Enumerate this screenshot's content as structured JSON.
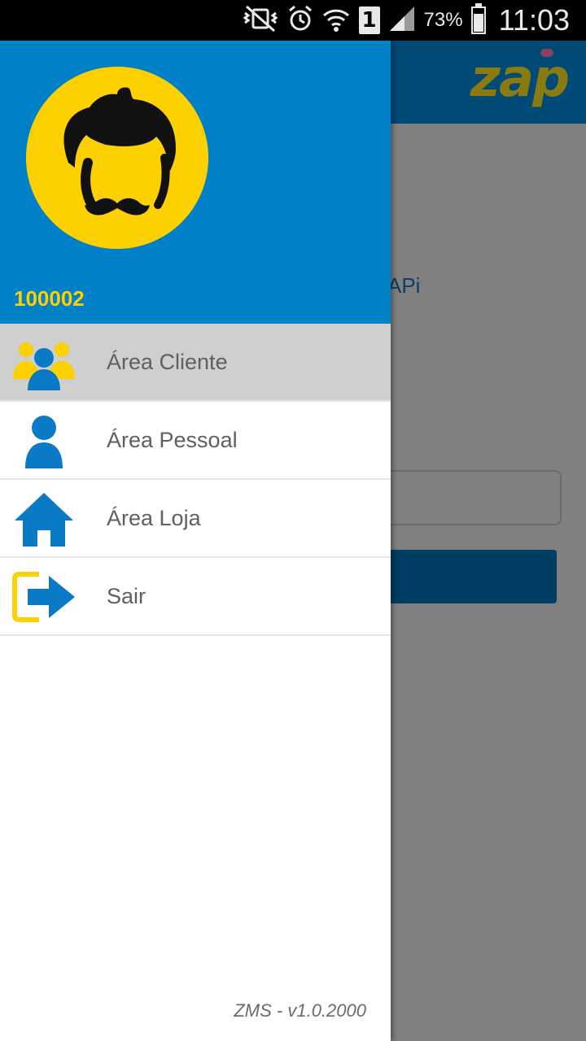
{
  "status_bar": {
    "battery_percent": "73%",
    "battery_level": 0.73,
    "time": "11:03",
    "sim_slot": "1",
    "icons": [
      "mute-vibrate-icon",
      "alarm-icon",
      "wifi-icon",
      "sim-icon",
      "signal-icon",
      "battery-icon"
    ]
  },
  "background_app": {
    "logo": "zap",
    "partial_label": "APi"
  },
  "drawer": {
    "user_id": "100002",
    "avatar_icon": "mustache-avatar-icon",
    "menu": [
      {
        "label": "Área Cliente",
        "icon": "people-group-icon",
        "active": true
      },
      {
        "label": "Área Pessoal",
        "icon": "person-icon",
        "active": false
      },
      {
        "label": "Área Loja",
        "icon": "home-icon",
        "active": false
      },
      {
        "label": "Sair",
        "icon": "logout-icon",
        "active": false
      }
    ],
    "version": "ZMS - v1.0.2000"
  },
  "colors": {
    "drawer_header": "#0080c6",
    "accent_yellow": "#fdd000",
    "icon_blue": "#0a7ac6",
    "active_item": "#cfcfcf",
    "text_gray": "#606060"
  }
}
